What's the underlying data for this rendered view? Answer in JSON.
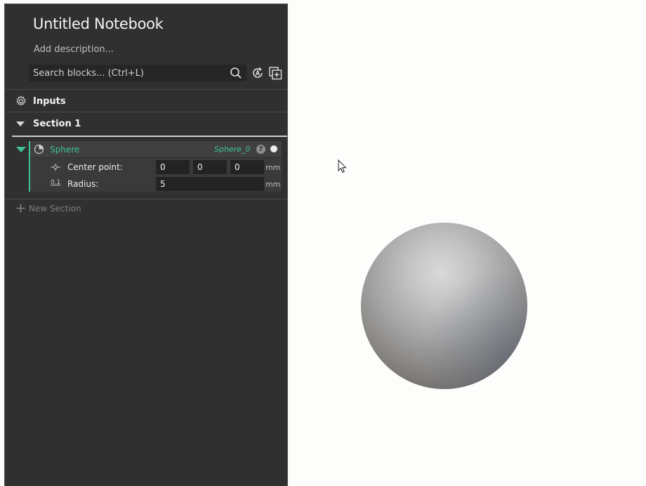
{
  "notebook": {
    "title": "Untitled Notebook",
    "description_placeholder": "Add description..."
  },
  "search": {
    "placeholder": "Search blocks... (Ctrl+L)"
  },
  "toolbar": {
    "icons": [
      "search-icon",
      "ai-assist-icon",
      "add-block-icon"
    ]
  },
  "inputs": {
    "label": "Inputs",
    "icon": "gear-icon"
  },
  "section": {
    "label": "Section 1"
  },
  "block": {
    "name": "Sphere",
    "variable": "Sphere_0",
    "help_label": "?",
    "accent_color": "#3fc199",
    "params": {
      "center": {
        "label": "Center point:",
        "x": "0",
        "y": "0",
        "z": "0",
        "unit": "mm"
      },
      "radius": {
        "label": "Radius:",
        "value": "5",
        "unit": "mm",
        "icon_text": "0.1"
      }
    }
  },
  "new_section": {
    "label": "New Section"
  },
  "viewport": {
    "object": "sphere",
    "background": "#fdfdfc"
  }
}
